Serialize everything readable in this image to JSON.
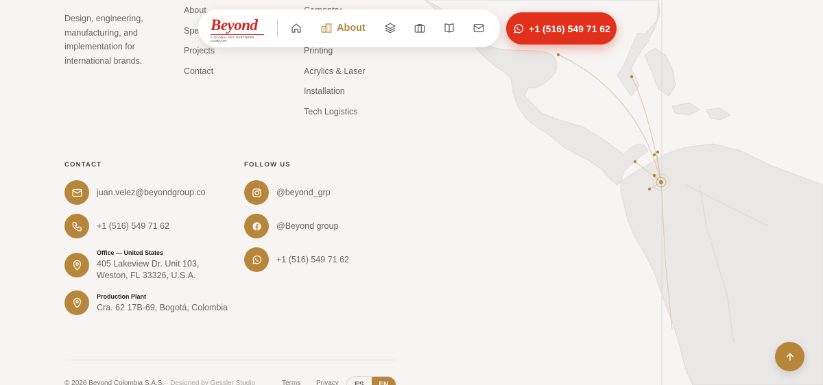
{
  "footer": {
    "tagline": "Design, engineering, manufacturing, and implementation for international brands.",
    "links_col1": [
      "About",
      "Spe",
      "Projects",
      "Contact"
    ],
    "links_col2": [
      "Carpentry",
      "",
      "Printing",
      "Acrylics & Laser",
      "Installation",
      "Tech Logistics"
    ]
  },
  "contact": {
    "title": "CONTACT",
    "email": "juan.velez@beyondgroup.co",
    "phone": "+1 (516) 549 71 62",
    "office_label": "Office — United States",
    "office_address_1": "405 Lakeview Dr. Unit 103,",
    "office_address_2": "Weston, FL 33326, U.S.A.",
    "plant_label": "Production Plant",
    "plant_address": "Cra. 62 17B-69, Bogotá, Colombia"
  },
  "follow": {
    "title": "FOLLOW US",
    "instagram": "@beyond_grp",
    "facebook": "@Beyond group",
    "whatsapp": "+1 (516) 549 71 62"
  },
  "bottom": {
    "copyright": "© 2026 Beyond Colombia S.A.S.",
    "designed": " · Designed by Gessler Studio",
    "terms": "Terms",
    "privacy": "Privacy",
    "lang_es": "ES",
    "lang_en": "EN"
  },
  "navbar": {
    "logo_text": "Beyond",
    "logo_sub": "A GLOBAL KEY PARTNERS COMPANY",
    "about_label": "About",
    "phone_label": "+1 (516) 549 71 62"
  },
  "colors": {
    "accent": "#b8863b",
    "cta": "#e1311d",
    "background": "#f6f5f4"
  }
}
